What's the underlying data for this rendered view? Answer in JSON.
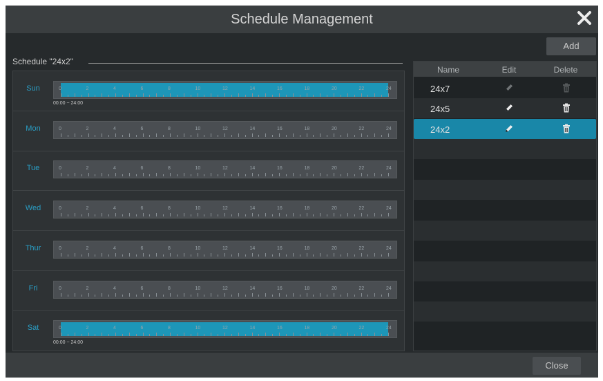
{
  "window": {
    "title": "Schedule Management",
    "close_icon": "close-icon"
  },
  "toolbar": {
    "add_label": "Add"
  },
  "schedule": {
    "label": "Schedule \"24x2\"",
    "hour_labels": [
      "0",
      "2",
      "4",
      "6",
      "8",
      "10",
      "12",
      "14",
      "16",
      "18",
      "20",
      "22",
      "24"
    ],
    "days": [
      {
        "name": "Sun",
        "selected_range": [
          0,
          24
        ],
        "range_text": "00:00 ~ 24:00"
      },
      {
        "name": "Mon",
        "selected_range": null,
        "range_text": ""
      },
      {
        "name": "Tue",
        "selected_range": null,
        "range_text": ""
      },
      {
        "name": "Wed",
        "selected_range": null,
        "range_text": ""
      },
      {
        "name": "Thur",
        "selected_range": null,
        "range_text": ""
      },
      {
        "name": "Fri",
        "selected_range": null,
        "range_text": ""
      },
      {
        "name": "Sat",
        "selected_range": [
          0,
          24
        ],
        "range_text": "00:00 ~ 24:00"
      }
    ],
    "colors": {
      "selected": "#1d96b8",
      "unselected": "#4a4e52",
      "day_label": "#2a9fc6"
    }
  },
  "schedule_list": {
    "headers": {
      "name": "Name",
      "edit": "Edit",
      "delete": "Delete"
    },
    "items": [
      {
        "name": "24x7",
        "edit_icon": "pencil-icon",
        "delete_icon": "trash-icon",
        "editable": false,
        "deletable": false,
        "selected": false
      },
      {
        "name": "24x5",
        "edit_icon": "pencil-icon",
        "delete_icon": "trash-icon",
        "editable": true,
        "deletable": true,
        "selected": false
      },
      {
        "name": "24x2",
        "edit_icon": "pencil-icon",
        "delete_icon": "trash-icon",
        "editable": true,
        "deletable": true,
        "selected": true
      }
    ],
    "empty_rows": 10,
    "colors": {
      "selected_row": "#1987a8"
    }
  },
  "footer": {
    "close_label": "Close"
  }
}
